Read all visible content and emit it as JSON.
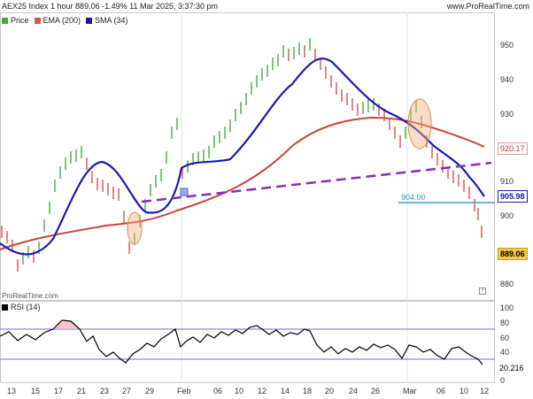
{
  "header": {
    "title": "AEX25 Index 1 hour 889.06 -1.49% 11 Mar 2025, 3:37:30 pm",
    "brand": "www.ProRealTime.com"
  },
  "legend": [
    {
      "label": "Price",
      "color": "#3aaa3a"
    },
    {
      "label": "EMA (200)",
      "color": "#d9534f"
    },
    {
      "label": "SMA (34)",
      "color": "#1a1a9f"
    }
  ],
  "price_axis": {
    "labels": [
      "950",
      "940",
      "930",
      "920",
      "910",
      "900",
      "890",
      "880"
    ]
  },
  "tags": {
    "ema": "920.17",
    "sma": "905.98",
    "last": "889.06",
    "support": "904.00"
  },
  "watermark": "ProRealTime.com",
  "rsi": {
    "legend": "RSI (14)",
    "axis_labels": [
      "100",
      "80",
      "60",
      "40",
      "20",
      "0"
    ],
    "value": "20.216"
  },
  "time_axis": {
    "labels": [
      "13",
      "15",
      "17",
      "21",
      "23",
      "27",
      "29",
      "Feb",
      "06",
      "10",
      "12",
      "14",
      "18",
      "20",
      "24",
      "26",
      "Mar",
      "06",
      "10",
      "12"
    ]
  },
  "icons": {
    "zoom": "zoom-icon"
  }
}
